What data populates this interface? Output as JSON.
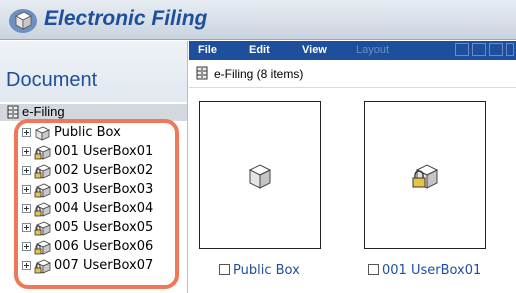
{
  "app": {
    "title": "Electronic Filing",
    "logo_icon": "box-cube-icon",
    "accent": "#1e4f9c",
    "highlight": "#f07858"
  },
  "left": {
    "header": "Document",
    "root": {
      "label": "e-Filing",
      "icon": "cabinet-icon"
    },
    "items": [
      {
        "label": "Public Box",
        "icon": "box-icon",
        "locked": false
      },
      {
        "label": "001 UserBox01",
        "icon": "locked-box-icon",
        "locked": true
      },
      {
        "label": "002 UserBox02",
        "icon": "locked-box-icon",
        "locked": true
      },
      {
        "label": "003 UserBox03",
        "icon": "locked-box-icon",
        "locked": true
      },
      {
        "label": "004 UserBox04",
        "icon": "locked-box-icon",
        "locked": true
      },
      {
        "label": "005 UserBox05",
        "icon": "locked-box-icon",
        "locked": true
      },
      {
        "label": "006 UserBox06",
        "icon": "locked-box-icon",
        "locked": true
      },
      {
        "label": "007 UserBox07",
        "icon": "locked-box-icon",
        "locked": true
      }
    ]
  },
  "menu": {
    "file": "File",
    "edit": "Edit",
    "view": "View",
    "layout": "Layout"
  },
  "path": {
    "label": "e-Filing  (8 items)"
  },
  "cards": [
    {
      "label": "Public Box",
      "locked": false,
      "checked": false
    },
    {
      "label": "001 UserBox01",
      "locked": true,
      "checked": false
    }
  ]
}
